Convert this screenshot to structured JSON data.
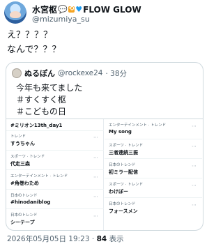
{
  "author": {
    "name": "水宮枢",
    "name_suffix": "FLOW GLOW",
    "handle": "@mizumiya_su"
  },
  "tweet": {
    "lines": [
      "え？？？？",
      "なんで？？？"
    ]
  },
  "quote": {
    "name": "ぬるぽん",
    "handle": "@rockexe24",
    "time": "· 38分",
    "lines": [
      "今年も来てました",
      "＃すくすく枢",
      "＃こどもの日"
    ]
  },
  "trends": {
    "left": [
      {
        "context": "",
        "title": "#ミリオン13th_day1"
      },
      {
        "context": "トレンド",
        "title": "すうちゃん"
      },
      {
        "context": "スポーツ · トレンド",
        "title": "代走三森"
      },
      {
        "context": "エンターテインメント · トレンド",
        "title": "#角巻わため"
      },
      {
        "context": "日本のトレンド",
        "title": "#hinodaniblog"
      },
      {
        "context": "日本のトレンド",
        "title": "シーテープ"
      }
    ],
    "right": [
      {
        "context": "エンターテインメント · トレンド",
        "title": "My song"
      },
      {
        "context": "スポーツ · トレンド",
        "title": "三者連続三振"
      },
      {
        "context": "日本のトレンド",
        "title": "初ミラー配信"
      },
      {
        "context": "スポーツ · トレンド",
        "title": "わけぽー"
      },
      {
        "context": "日本のトレンド",
        "title": "フォースメン"
      }
    ]
  },
  "footer": {
    "timestamp": "2026年05月05日 19:23 · ",
    "views_count": "84",
    "views_label": " 表示"
  }
}
